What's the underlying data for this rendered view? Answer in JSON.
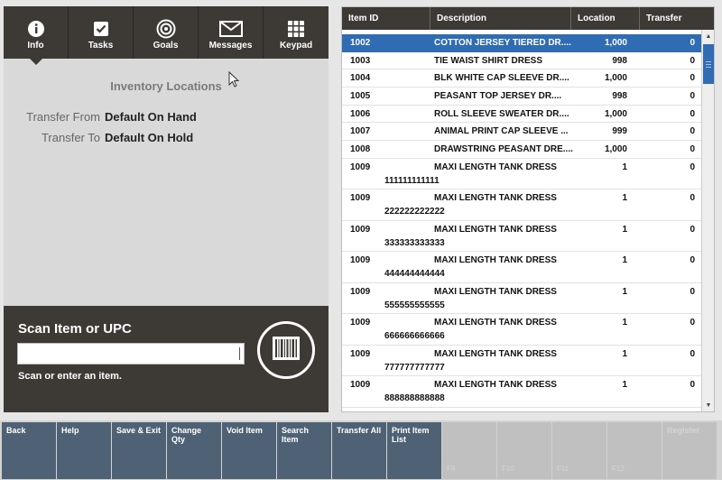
{
  "nav": {
    "items": [
      {
        "label": "Info",
        "icon": "info-icon",
        "active": true
      },
      {
        "label": "Tasks",
        "icon": "checkbox-icon"
      },
      {
        "label": "Goals",
        "icon": "target-icon"
      },
      {
        "label": "Messages",
        "icon": "envelope-icon"
      },
      {
        "label": "Keypad",
        "icon": "keypad-icon"
      }
    ]
  },
  "info": {
    "title": "Inventory Locations",
    "transfer_from_label": "Transfer From",
    "transfer_from_value": "Default On Hand",
    "transfer_to_label": "Transfer To",
    "transfer_to_value": "Default On Hold"
  },
  "scan": {
    "title": "Scan Item or UPC",
    "input_value": "",
    "hint": "Scan or enter an item."
  },
  "grid": {
    "columns": [
      "Item ID",
      "Description",
      "Location",
      "Transfer"
    ],
    "rows": [
      {
        "id": "1002",
        "desc": "COTTON JERSEY TIERED DR....",
        "loc": "1,000",
        "tr": "0",
        "sub": ""
      },
      {
        "id": "1003",
        "desc": "TIE WAIST SHIRT DRESS",
        "loc": "998",
        "tr": "0",
        "sub": ""
      },
      {
        "id": "1004",
        "desc": "BLK WHITE CAP SLEEVE DR....",
        "loc": "1,000",
        "tr": "0",
        "sub": ""
      },
      {
        "id": "1005",
        "desc": "PEASANT TOP JERSEY DR....",
        "loc": "998",
        "tr": "0",
        "sub": ""
      },
      {
        "id": "1006",
        "desc": "ROLL SLEEVE SWEATER DR....",
        "loc": "1,000",
        "tr": "0",
        "sub": ""
      },
      {
        "id": "1007",
        "desc": "ANIMAL PRINT CAP SLEEVE ...",
        "loc": "999",
        "tr": "0",
        "sub": ""
      },
      {
        "id": "1008",
        "desc": "DRAWSTRING PEASANT DRE....",
        "loc": "1,000",
        "tr": "0",
        "sub": ""
      },
      {
        "id": "1009",
        "desc": "MAXI LENGTH TANK DRESS",
        "loc": "1",
        "tr": "0",
        "sub": "111111111111"
      },
      {
        "id": "1009",
        "desc": "MAXI LENGTH TANK DRESS",
        "loc": "1",
        "tr": "0",
        "sub": "222222222222"
      },
      {
        "id": "1009",
        "desc": "MAXI LENGTH TANK DRESS",
        "loc": "1",
        "tr": "0",
        "sub": "333333333333"
      },
      {
        "id": "1009",
        "desc": "MAXI LENGTH TANK DRESS",
        "loc": "1",
        "tr": "0",
        "sub": "444444444444"
      },
      {
        "id": "1009",
        "desc": "MAXI LENGTH TANK DRESS",
        "loc": "1",
        "tr": "0",
        "sub": "555555555555"
      },
      {
        "id": "1009",
        "desc": "MAXI LENGTH TANK DRESS",
        "loc": "1",
        "tr": "0",
        "sub": "666666666666"
      },
      {
        "id": "1009",
        "desc": "MAXI LENGTH TANK DRESS",
        "loc": "1",
        "tr": "0",
        "sub": "777777777777"
      },
      {
        "id": "1009",
        "desc": "MAXI LENGTH TANK DRESS",
        "loc": "1",
        "tr": "0",
        "sub": "888888888888"
      },
      {
        "id": "1009",
        "desc": "MAXI LENGTH TANK DRESS",
        "loc": "1",
        "tr": "0",
        "sub": ""
      }
    ]
  },
  "function_keys": [
    {
      "label": "Back",
      "enabled": true,
      "num": ""
    },
    {
      "label": "Help",
      "enabled": true,
      "num": ""
    },
    {
      "label": "Save & Exit",
      "enabled": true,
      "num": ""
    },
    {
      "label": "Change Qty",
      "enabled": true,
      "num": ""
    },
    {
      "label": "Void Item",
      "enabled": true,
      "num": ""
    },
    {
      "label": "Search Item",
      "enabled": true,
      "num": ""
    },
    {
      "label": "Transfer All",
      "enabled": true,
      "num": ""
    },
    {
      "label": "Print Item List",
      "enabled": true,
      "num": ""
    },
    {
      "label": "",
      "enabled": false,
      "num": "F9"
    },
    {
      "label": "",
      "enabled": false,
      "num": "F10"
    },
    {
      "label": "",
      "enabled": false,
      "num": "F11"
    },
    {
      "label": "",
      "enabled": false,
      "num": "F12"
    },
    {
      "label": "Register",
      "enabled": false,
      "num": ""
    }
  ],
  "colors": {
    "dark_panel": "#3d3a36",
    "selected_row": "#2f6cb3",
    "function_key": "#4f6275"
  }
}
